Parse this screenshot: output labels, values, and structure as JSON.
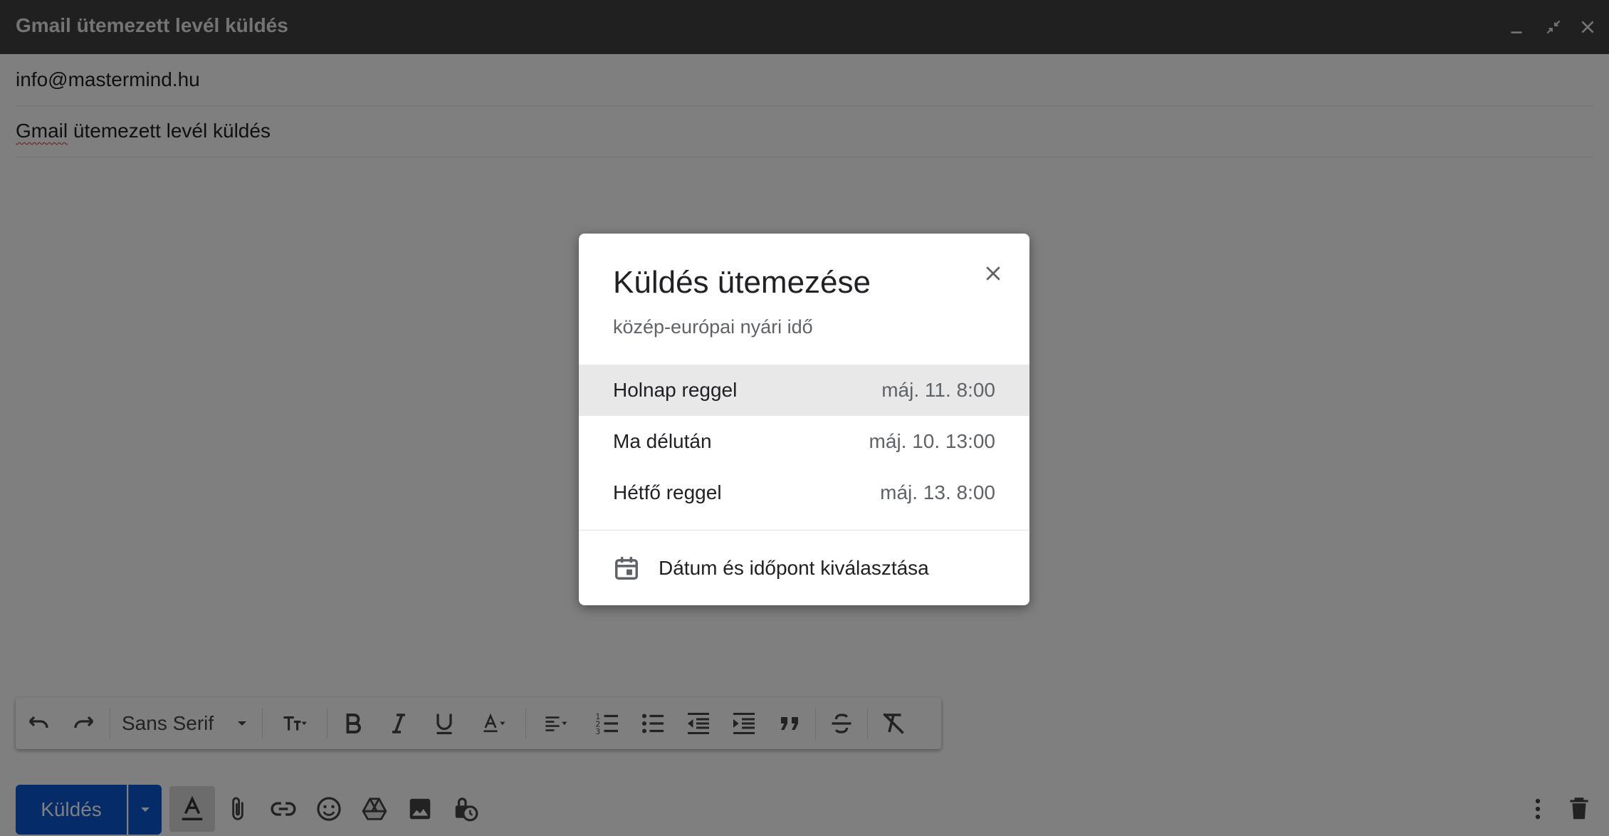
{
  "window": {
    "title": "Gmail ütemezett levél küldés"
  },
  "compose": {
    "to": "info@mastermind.hu",
    "subject_first": "Gmail",
    "subject_rest": " ütemezett levél küldés"
  },
  "format_toolbar": {
    "font": "Sans Serif"
  },
  "bottom_bar": {
    "send_label": "Küldés"
  },
  "schedule_dialog": {
    "title": "Küldés ütemezése",
    "subtitle": "közép-európai nyári idő",
    "options": [
      {
        "label": "Holnap reggel",
        "datetime": "máj. 11. 8:00"
      },
      {
        "label": "Ma délután",
        "datetime": "máj. 10. 13:00"
      },
      {
        "label": "Hétfő reggel",
        "datetime": "máj. 13. 8:00"
      }
    ],
    "custom_label": "Dátum és időpont kiválasztása"
  },
  "colors": {
    "send_button": "#0b57d0",
    "title_bar": "#404040",
    "overlay": "rgba(0,0,0,0.5)",
    "selected_option": "#e8e8e8"
  }
}
